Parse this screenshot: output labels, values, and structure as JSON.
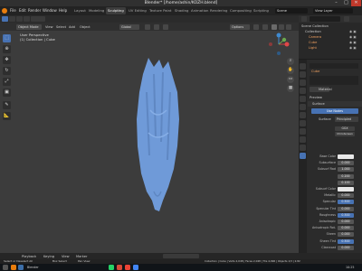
{
  "title_bar": {
    "title": "Blender* [/home/ashin/KOZH.blend]",
    "min": "–",
    "max": "□",
    "close": "✕"
  },
  "menu": {
    "items": [
      "File",
      "Edit",
      "Render",
      "Window",
      "Help"
    ],
    "workspaces": [
      "Layout",
      "Modeling",
      "Sculpting",
      "UV Editing",
      "Texture Paint",
      "Shading",
      "Animation",
      "Rendering",
      "Compositing",
      "Scripting"
    ],
    "active_workspace": "Sculpting",
    "scene_value": "Scene",
    "view_layer_value": "View Layer"
  },
  "toolbar": {
    "mode_label": "Object Mode",
    "view": "View",
    "select": "Select",
    "add": "Add",
    "object": "Object",
    "transform": "Global",
    "pivot": "Options"
  },
  "viewport": {
    "view_name": "User Perspective",
    "collection_line": "(1) Collection | Cube",
    "mesh_color": "#6f9ad8"
  },
  "outliner": {
    "header": "Scene Collection",
    "rows": [
      "Collection",
      "Camera",
      "Cube",
      "Light"
    ]
  },
  "properties": {
    "object_name": "Cube",
    "material_slot": "Material",
    "preview_label": "Preview",
    "surface_label": "Surface",
    "use_nodes": "Use Nodes",
    "surface_type_label": "Surface",
    "surface_type_value": "Principled",
    "distribution": "GGX",
    "subsurface_method": "Christensen",
    "rows": [
      {
        "label": "Base Color",
        "value": "",
        "style": "white"
      },
      {
        "label": "Subsurface",
        "value": "0.000",
        "style": "grey"
      },
      {
        "label": "Subsurf Rad",
        "value": "1.000",
        "style": "grey"
      },
      {
        "label": "",
        "value": "0.200",
        "style": "grey"
      },
      {
        "label": "",
        "value": "0.100",
        "style": "grey"
      },
      {
        "label": "Subsurf Color",
        "value": "",
        "style": "white"
      },
      {
        "label": "Metallic",
        "value": "0.000",
        "style": "grey"
      },
      {
        "label": "Specular",
        "value": "0.500",
        "style": "blue"
      },
      {
        "label": "Specular Tint",
        "value": "0.000",
        "style": "grey"
      },
      {
        "label": "Roughness",
        "value": "0.500",
        "style": "blue"
      },
      {
        "label": "Anisotropic",
        "value": "0.000",
        "style": "grey"
      },
      {
        "label": "Anisotropic Rot.",
        "value": "0.000",
        "style": "grey"
      },
      {
        "label": "Sheen",
        "value": "0.000",
        "style": "grey"
      },
      {
        "label": "Sheen Tint",
        "value": "0.500",
        "style": "blue"
      },
      {
        "label": "Clearcoat",
        "value": "0.000",
        "style": "grey"
      }
    ]
  },
  "timeline": {
    "playback": "Playback",
    "keying": "Keying",
    "view": "View",
    "marker": "Marker"
  },
  "status": {
    "left": "Select or Deselect All",
    "middle": "Box Select",
    "right_action": "Pan View",
    "far_right": "Collection | Cube | Verts 2,048 | Faces 2,048 | Tris 4,096 | Objects 1/3 | 2.82"
  },
  "taskbar": {
    "app_label": "Blender",
    "time": "10:25"
  }
}
